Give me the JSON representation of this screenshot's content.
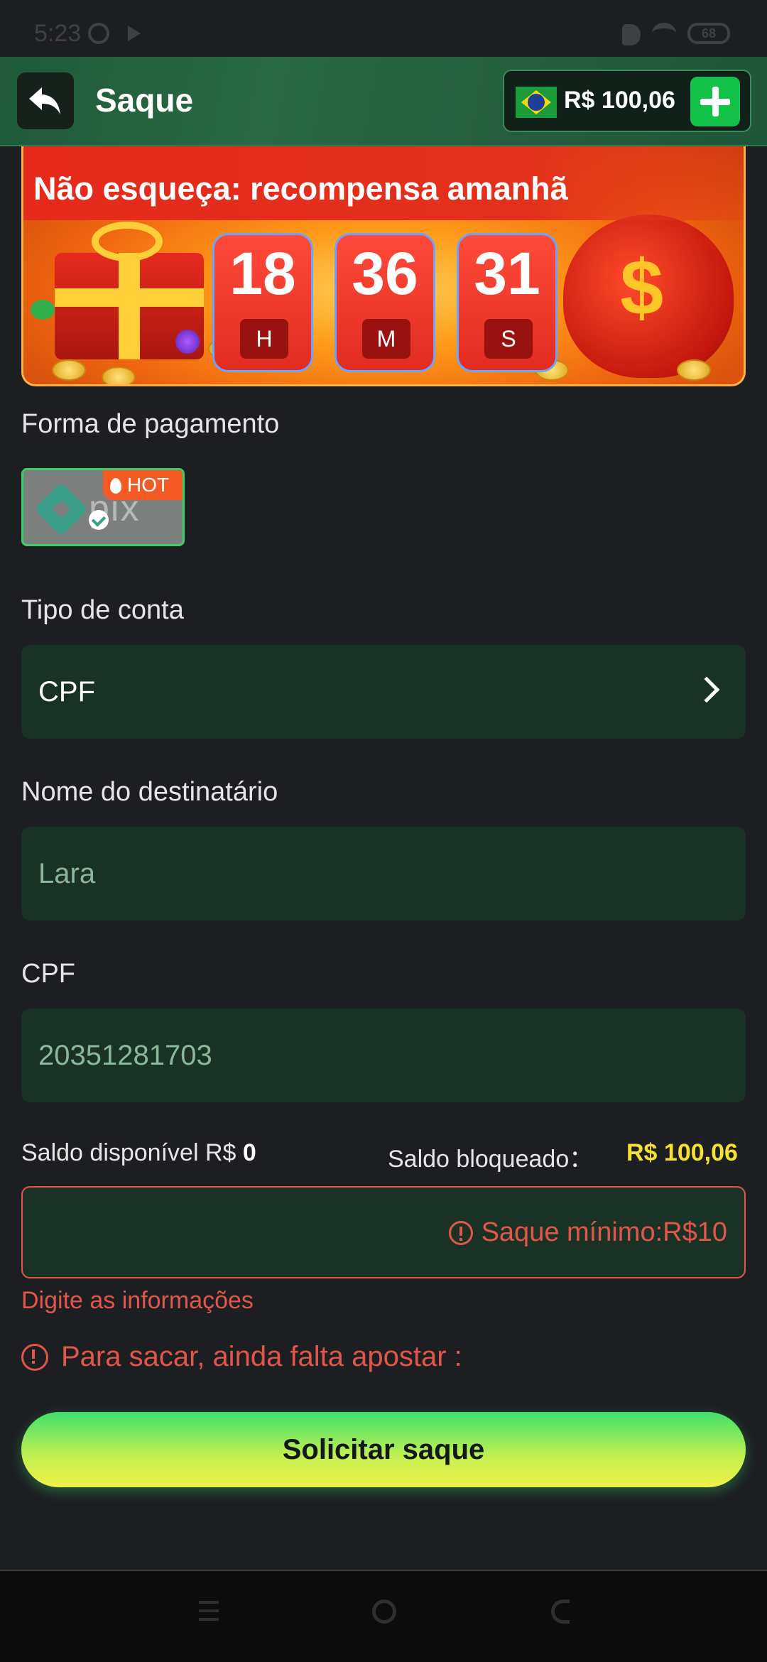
{
  "status_bar": {
    "time": "5:23",
    "battery": "68"
  },
  "header": {
    "title": "Saque",
    "balance": "R$ 100,06"
  },
  "banner": {
    "title": "Não esqueça: recompensa amanhã",
    "countdown": [
      {
        "value": "18",
        "unit": "H"
      },
      {
        "value": "36",
        "unit": "M"
      },
      {
        "value": "31",
        "unit": "S"
      }
    ]
  },
  "payment": {
    "label": "Forma de pagamento",
    "method_text": "pix",
    "badge": "HOT"
  },
  "account_type": {
    "label": "Tipo de conta",
    "value": "CPF"
  },
  "recipient": {
    "label": "Nome do destinatário",
    "value": "Lara"
  },
  "cpf": {
    "label": "CPF",
    "value": "20351281703"
  },
  "balances": {
    "available_label": "Saldo disponível R$",
    "available_value": "0",
    "blocked_label": "Saldo bloqueado：",
    "blocked_value": "R$ 100,06"
  },
  "amount": {
    "placeholder": "Saque mínimo:R$10"
  },
  "errors": {
    "field_error": "Digite as informações",
    "bet_warning": "Para sacar, ainda falta apostar :"
  },
  "submit": {
    "label": "Solicitar saque"
  },
  "colors": {
    "accent_green": "#14c24a",
    "error_red": "#e2564a",
    "highlight_yellow": "#f4e232",
    "field_bg": "#1a3226"
  }
}
